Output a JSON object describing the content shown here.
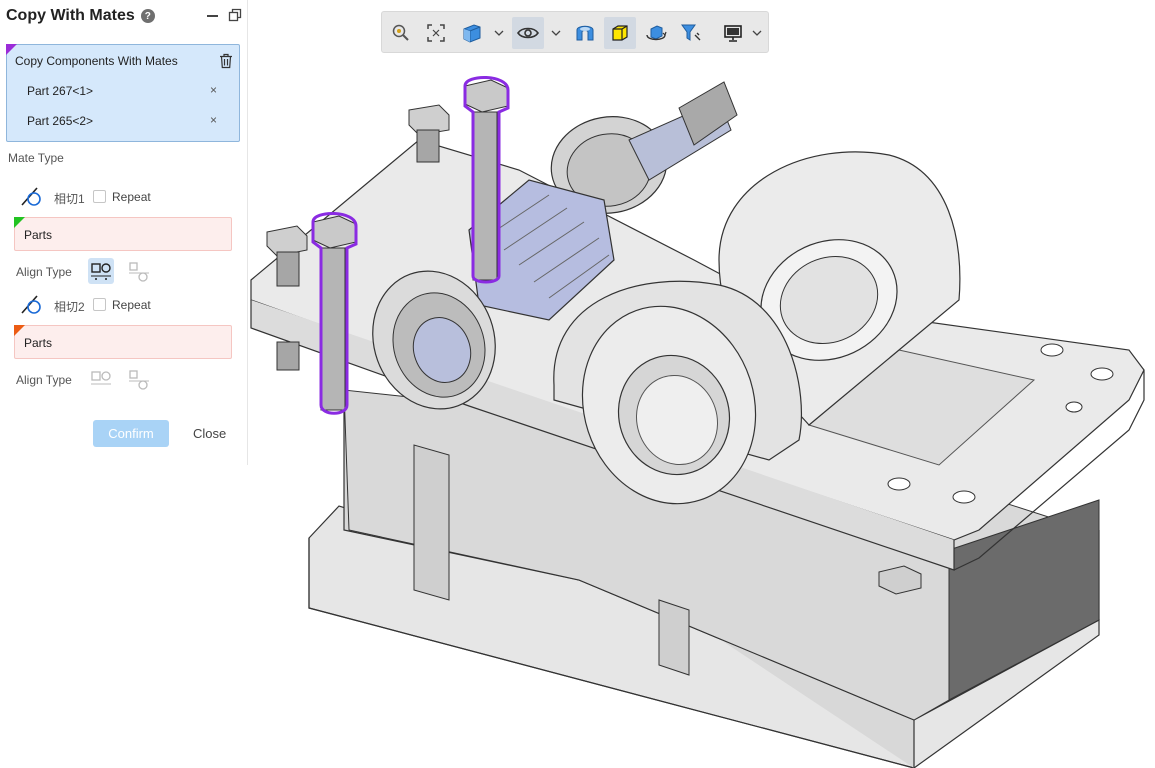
{
  "panel": {
    "title": "Copy With Mates",
    "help_icon": "?",
    "minimize_icon": "minimize-icon",
    "restore_icon": "restore-window-icon",
    "components": {
      "title": "Copy Components With Mates",
      "items": [
        {
          "label": "Part 267<1>",
          "remove": "×"
        },
        {
          "label": "Part 265<2>",
          "remove": "×"
        }
      ]
    },
    "mate_type_label": "Mate Type",
    "mates": [
      {
        "name": "相切1",
        "repeat_label": "Repeat",
        "repeat_checked": false,
        "parts_label": "Parts",
        "align_label": "Align Type",
        "tag_color": "#22c322"
      },
      {
        "name": "相切2",
        "repeat_label": "Repeat",
        "repeat_checked": false,
        "parts_label": "Parts",
        "align_label": "Align Type",
        "tag_color": "#ec5c14"
      }
    ],
    "confirm_label": "Confirm",
    "close_label": "Close"
  },
  "toolbar": {
    "buttons": [
      "zoom-icon",
      "zoom-to-fit-icon",
      "view-cube-icon",
      "visibility-eye-icon",
      "section-view-icon",
      "display-style-icon",
      "rotate-view-icon",
      "filter-icon",
      "monitor-icon"
    ]
  },
  "colors": {
    "selection_outline": "#8a2be2",
    "accent": "#a9d3f6",
    "panel_highlight": "#d5e8fb",
    "error_bg": "#fdeeed"
  }
}
